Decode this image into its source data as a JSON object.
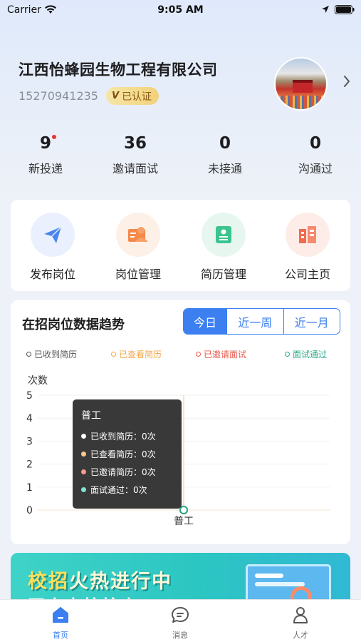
{
  "status_bar": {
    "carrier": "Carrier",
    "time": "9:05 AM"
  },
  "company": {
    "name": "江西怡蜂园生物工程有限公司",
    "phone": "15270941235",
    "verified_icon": "V",
    "verified_label": "已认证"
  },
  "stats": [
    {
      "value": "9",
      "label": "新投递",
      "has_dot": true
    },
    {
      "value": "36",
      "label": "邀请面试"
    },
    {
      "value": "0",
      "label": "未接通"
    },
    {
      "value": "0",
      "label": "沟通过"
    }
  ],
  "actions": [
    {
      "label": "发布岗位",
      "icon": "paper-plane-icon",
      "bg": "#eaf0fd",
      "color": "#4a86f0"
    },
    {
      "label": "岗位管理",
      "icon": "person-card-icon",
      "bg": "#fdf0e6",
      "color": "#f4894a"
    },
    {
      "label": "简历管理",
      "icon": "resume-icon",
      "bg": "#e7f7f0",
      "color": "#3cc48f"
    },
    {
      "label": "公司主页",
      "icon": "building-icon",
      "bg": "#fdece8",
      "color": "#f26b4f"
    }
  ],
  "trend": {
    "title": "在招岗位数据趋势",
    "tabs": [
      "今日",
      "近一周",
      "近一月"
    ],
    "active_tab": 0
  },
  "chart_data": {
    "type": "line",
    "categories": [
      "普工"
    ],
    "ylabel": "次数",
    "ylim": [
      0,
      5
    ],
    "yticks": [
      "0",
      "1",
      "2",
      "3",
      "4",
      "5"
    ],
    "series": [
      {
        "name": "已收到简历",
        "values": [
          0
        ],
        "color": "#555555"
      },
      {
        "name": "已查看简历",
        "values": [
          0
        ],
        "color": "#f5a74a"
      },
      {
        "name": "已邀请面试",
        "values": [
          0
        ],
        "color": "#e8594a"
      },
      {
        "name": "面试通过",
        "values": [
          0
        ],
        "color": "#2aa98a"
      }
    ],
    "legend_position": "top"
  },
  "tooltip": {
    "title": "普工",
    "rows": [
      {
        "text": "已收到简历：0次",
        "color": "#ffffff"
      },
      {
        "text": "已查看简历：0次",
        "color": "#f5c98a"
      },
      {
        "text": "已邀请简历：0次",
        "color": "#f59a8a"
      },
      {
        "text": "面试通过：0次",
        "color": "#7fe6d0"
      }
    ]
  },
  "banner": {
    "text_a": "校招",
    "text_b": "火热进行中",
    "sub": "开启高校抢人"
  },
  "tabbar": [
    {
      "label": "首页",
      "icon": "home-icon",
      "active": true
    },
    {
      "label": "消息",
      "icon": "chat-bubble-icon",
      "active": false
    },
    {
      "label": "人才",
      "icon": "person-icon",
      "active": false
    }
  ],
  "colors": {
    "accent": "#3b7ff0",
    "inactive": "#666666"
  }
}
